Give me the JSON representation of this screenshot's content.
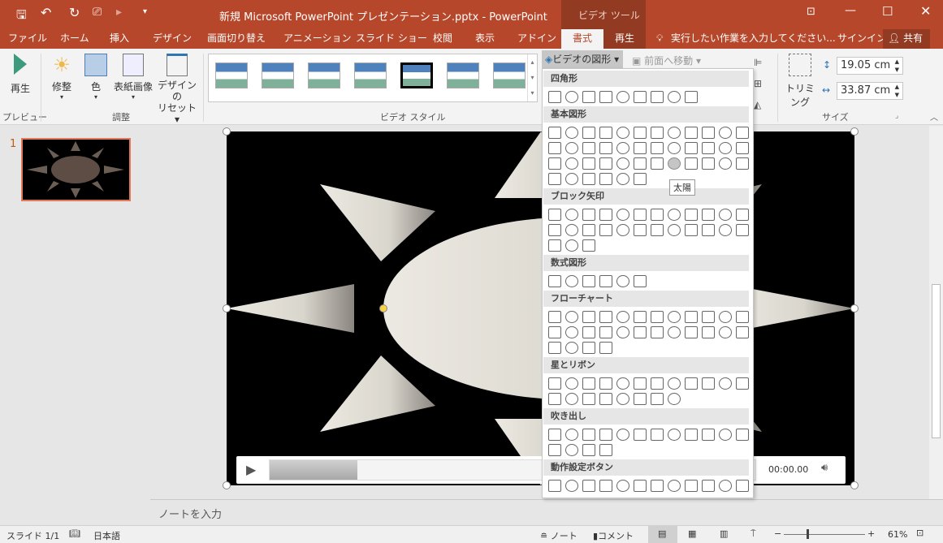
{
  "title": "新規 Microsoft PowerPoint プレゼンテーション.pptx - PowerPoint",
  "context_tab": "ビデオ ツール",
  "tabs": [
    "ファイル",
    "ホーム",
    "挿入",
    "デザイン",
    "画面切り替え",
    "アニメーション",
    "スライド ショー",
    "校閲",
    "表示",
    "アドイン",
    "書式",
    "再生"
  ],
  "active_tab": "書式",
  "tell_me": "実行したい作業を入力してください...",
  "signin": "サインイン",
  "share": "共有",
  "ribbon": {
    "play": "再生",
    "preview_group": "プレビュー",
    "corrections": "修整",
    "color": "色",
    "poster": "表紙画像",
    "reset1": "デザインの",
    "reset2": "リセット",
    "adjust_group": "調整",
    "style_group": "ビデオ スタイル",
    "video_shape": "ビデオの図形",
    "bring_forward": "前面へ移動",
    "crop": "トリミング",
    "height": "19.05 cm",
    "width": "33.87 cm",
    "size_group": "サイズ"
  },
  "thumbnail": {
    "number": "1"
  },
  "dropdown": {
    "sections": [
      {
        "title": "四角形",
        "count": 9
      },
      {
        "title": "基本図形",
        "count": 42
      },
      {
        "title": "ブロック矢印",
        "count": 27
      },
      {
        "title": "数式図形",
        "count": 6
      },
      {
        "title": "フローチャート",
        "count": 28
      },
      {
        "title": "星とリボン",
        "count": 20
      },
      {
        "title": "吹き出し",
        "count": 16
      },
      {
        "title": "動作設定ボタン",
        "count": 12
      }
    ],
    "tooltip": "太陽"
  },
  "player": {
    "time": "00:00.00",
    "progress_percent": 18
  },
  "notes_placeholder": "ノートを入力",
  "status": {
    "slide": "スライド 1/1",
    "language": "日本語",
    "notes": "ノート",
    "comments": "コメント",
    "zoom": "61%"
  },
  "colors": {
    "accent": "#b7472a",
    "tab_dark": "#933a22"
  }
}
